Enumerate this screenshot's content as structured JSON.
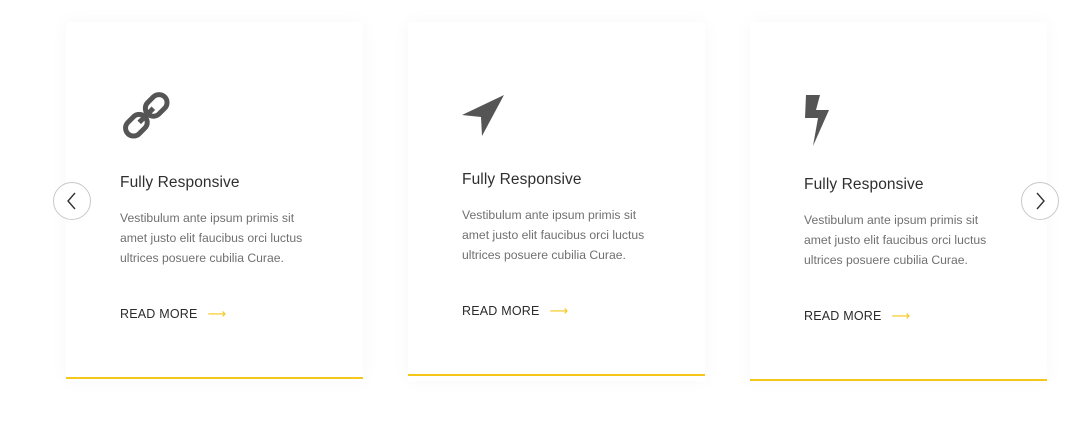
{
  "carousel": {
    "prev_icon": "chevron-left-icon",
    "next_icon": "chevron-right-icon",
    "accent_color": "#f6c71b",
    "cards": [
      {
        "icon": "link-icon",
        "title": "Fully Responsive",
        "text": "Vestibulum ante ipsum primis sit amet justo elit faucibus orci luctus ultrices posuere cubilia Curae.",
        "link_label": "READ MORE",
        "link_arrow": "⟶"
      },
      {
        "icon": "location-arrow-icon",
        "title": "Fully Responsive",
        "text": "Vestibulum ante ipsum primis sit amet justo elit faucibus orci luctus ultrices posuere cubilia Curae.",
        "link_label": "READ MORE",
        "link_arrow": "⟶"
      },
      {
        "icon": "lightning-bolt-icon",
        "title": "Fully Responsive",
        "text": "Vestibulum ante ipsum primis sit amet justo elit faucibus orci luctus ultrices posuere cubilia Curae.",
        "link_label": "READ MORE",
        "link_arrow": "⟶"
      }
    ]
  }
}
